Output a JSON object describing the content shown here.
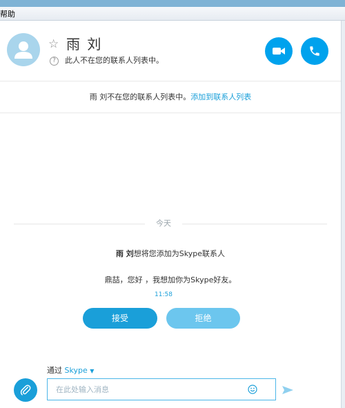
{
  "menu": {
    "help": "帮助"
  },
  "contact": {
    "name": "雨 刘",
    "status": "此人不在您的联系人列表中。"
  },
  "notice": {
    "text": "雨 刘不在您的联系人列表中。",
    "link": "添加到联系人列表"
  },
  "conversation": {
    "date_divider": "今天",
    "request_sender": "雨 刘",
    "request_text": "想将您添加为Skype联系人",
    "greeting": "鼎喆，您好 ，我想加你为Skype好友。",
    "time": "11:58",
    "accept_label": "接受",
    "decline_label": "拒绝"
  },
  "composer": {
    "via_label": "通过",
    "via_service": "Skype",
    "placeholder": "在此处输入消息"
  },
  "colors": {
    "accent": "#00a2ed",
    "link": "#1a9fd9",
    "decline": "#6cc6ee",
    "avatar_bg": "#a9d5ec"
  },
  "icons": {
    "avatar": "person-icon",
    "favorite": "star-outline-icon",
    "info": "info-icon",
    "video": "video-camera-icon",
    "call": "phone-icon",
    "attach": "paperclip-icon",
    "emoji": "smiley-icon",
    "send": "send-icon",
    "dropdown": "chevron-down-icon"
  }
}
